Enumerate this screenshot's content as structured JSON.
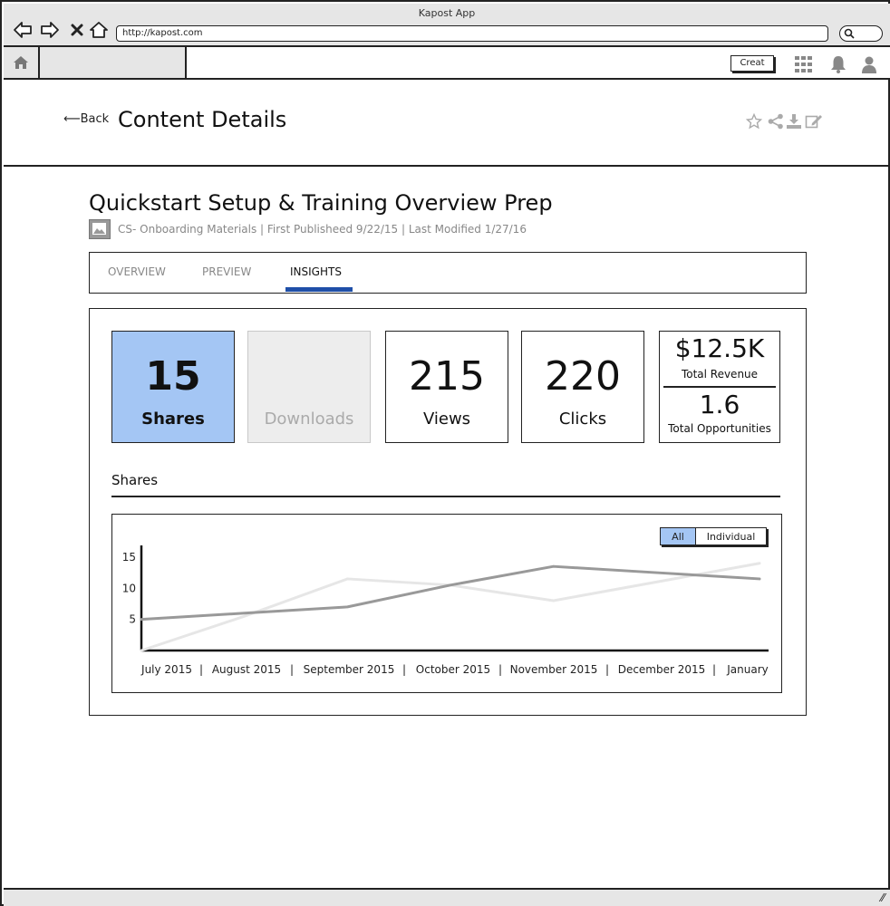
{
  "window": {
    "title": "Kapost App"
  },
  "browser": {
    "url": "http://kapost.com"
  },
  "nav": {
    "create_label": "Creat"
  },
  "header": {
    "back_label": "Back",
    "title": "Content Details"
  },
  "content": {
    "title": "Quickstart Setup & Training Overview Prep",
    "meta": "CS- Onboarding Materials | First Publisheed 9/22/15 | Last Modified 1/27/16"
  },
  "tabs": [
    {
      "label": "OVERVIEW",
      "active": false
    },
    {
      "label": "PREVIEW",
      "active": false
    },
    {
      "label": "INSIGHTS",
      "active": true
    }
  ],
  "stats": {
    "shares": {
      "value": "15",
      "label": "Shares"
    },
    "downloads": {
      "label": "Downloads"
    },
    "views": {
      "value": "215",
      "label": "Views"
    },
    "clicks": {
      "value": "220",
      "label": "Clicks"
    },
    "revenue": {
      "value": "$12.5K",
      "label": "Total Revenue"
    },
    "opportunities": {
      "value": "1.6",
      "label": "Total Opportunities"
    }
  },
  "section": {
    "label": "Shares"
  },
  "toggle": {
    "all": "All",
    "individual": "Individual",
    "selected": "All"
  },
  "colors": {
    "accent": "#a4c6f4",
    "tab_underline": "#1f4fa8",
    "series_dark": "#999999",
    "series_light": "#e6e6e6"
  },
  "chart_data": {
    "type": "line",
    "categories": [
      "July 2015",
      "August 2015",
      "September 2015",
      "October 2015",
      "November 2015",
      "December 2015",
      "January"
    ],
    "yticks": [
      5,
      10,
      15
    ],
    "ylim": [
      0,
      16
    ],
    "series": [
      {
        "values": [
          5,
          6,
          7,
          10.5,
          13.5,
          12.5,
          11.5
        ]
      },
      {
        "values": [
          0,
          5.5,
          11.5,
          10.5,
          8,
          11,
          14
        ]
      }
    ],
    "grid": false
  }
}
